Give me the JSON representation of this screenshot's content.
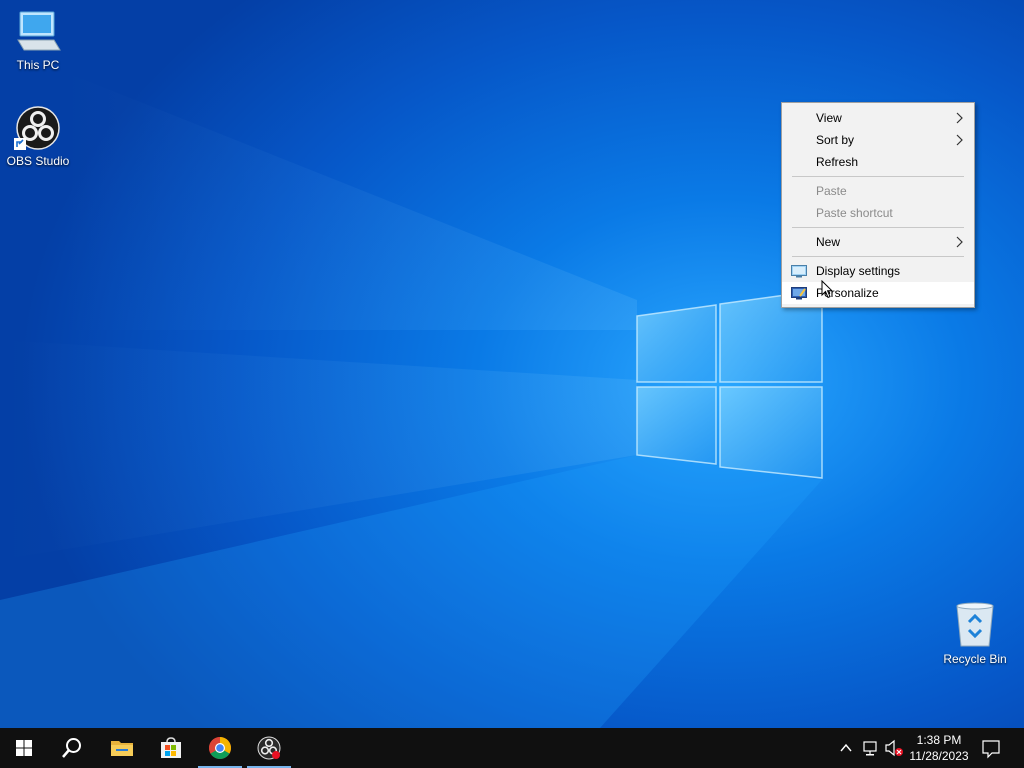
{
  "desktop": {
    "icons": [
      {
        "label": "This PC",
        "icon": "computer-icon"
      },
      {
        "label": "OBS Studio",
        "icon": "obs-icon"
      },
      {
        "label": "Recycle Bin",
        "icon": "recycle-bin-icon"
      }
    ]
  },
  "context_menu": {
    "items": [
      {
        "label": "View",
        "submenu": true,
        "enabled": true
      },
      {
        "label": "Sort by",
        "submenu": true,
        "enabled": true
      },
      {
        "label": "Refresh",
        "submenu": false,
        "enabled": true
      },
      {
        "label": "Paste",
        "submenu": false,
        "enabled": false
      },
      {
        "label": "Paste shortcut",
        "submenu": false,
        "enabled": false
      },
      {
        "label": "New",
        "submenu": true,
        "enabled": true
      },
      {
        "label": "Display settings",
        "icon": "display-icon",
        "enabled": true
      },
      {
        "label": "Personalize",
        "icon": "personalize-icon",
        "enabled": true,
        "hovered": true
      }
    ]
  },
  "taskbar": {
    "buttons": [
      {
        "name": "start",
        "icon": "windows-logo-icon"
      },
      {
        "name": "search",
        "icon": "search-icon"
      },
      {
        "name": "file-explorer",
        "icon": "folder-icon",
        "running": false
      },
      {
        "name": "microsoft-store",
        "icon": "store-icon",
        "running": false
      },
      {
        "name": "chrome",
        "icon": "chrome-icon",
        "running": true
      },
      {
        "name": "obs-studio",
        "icon": "obs-icon",
        "running": true
      }
    ],
    "tray": {
      "icons": [
        "chevron-up-icon",
        "network-icon",
        "volume-muted-icon"
      ],
      "time": "1:38 PM",
      "date": "11/28/2023",
      "notification_icon": "notification-icon"
    }
  },
  "colors": {
    "taskbar_bg": "#101010",
    "menu_bg": "#f2f2f2",
    "disabled_text": "#8b8b8b",
    "accent": "#0078d7"
  }
}
